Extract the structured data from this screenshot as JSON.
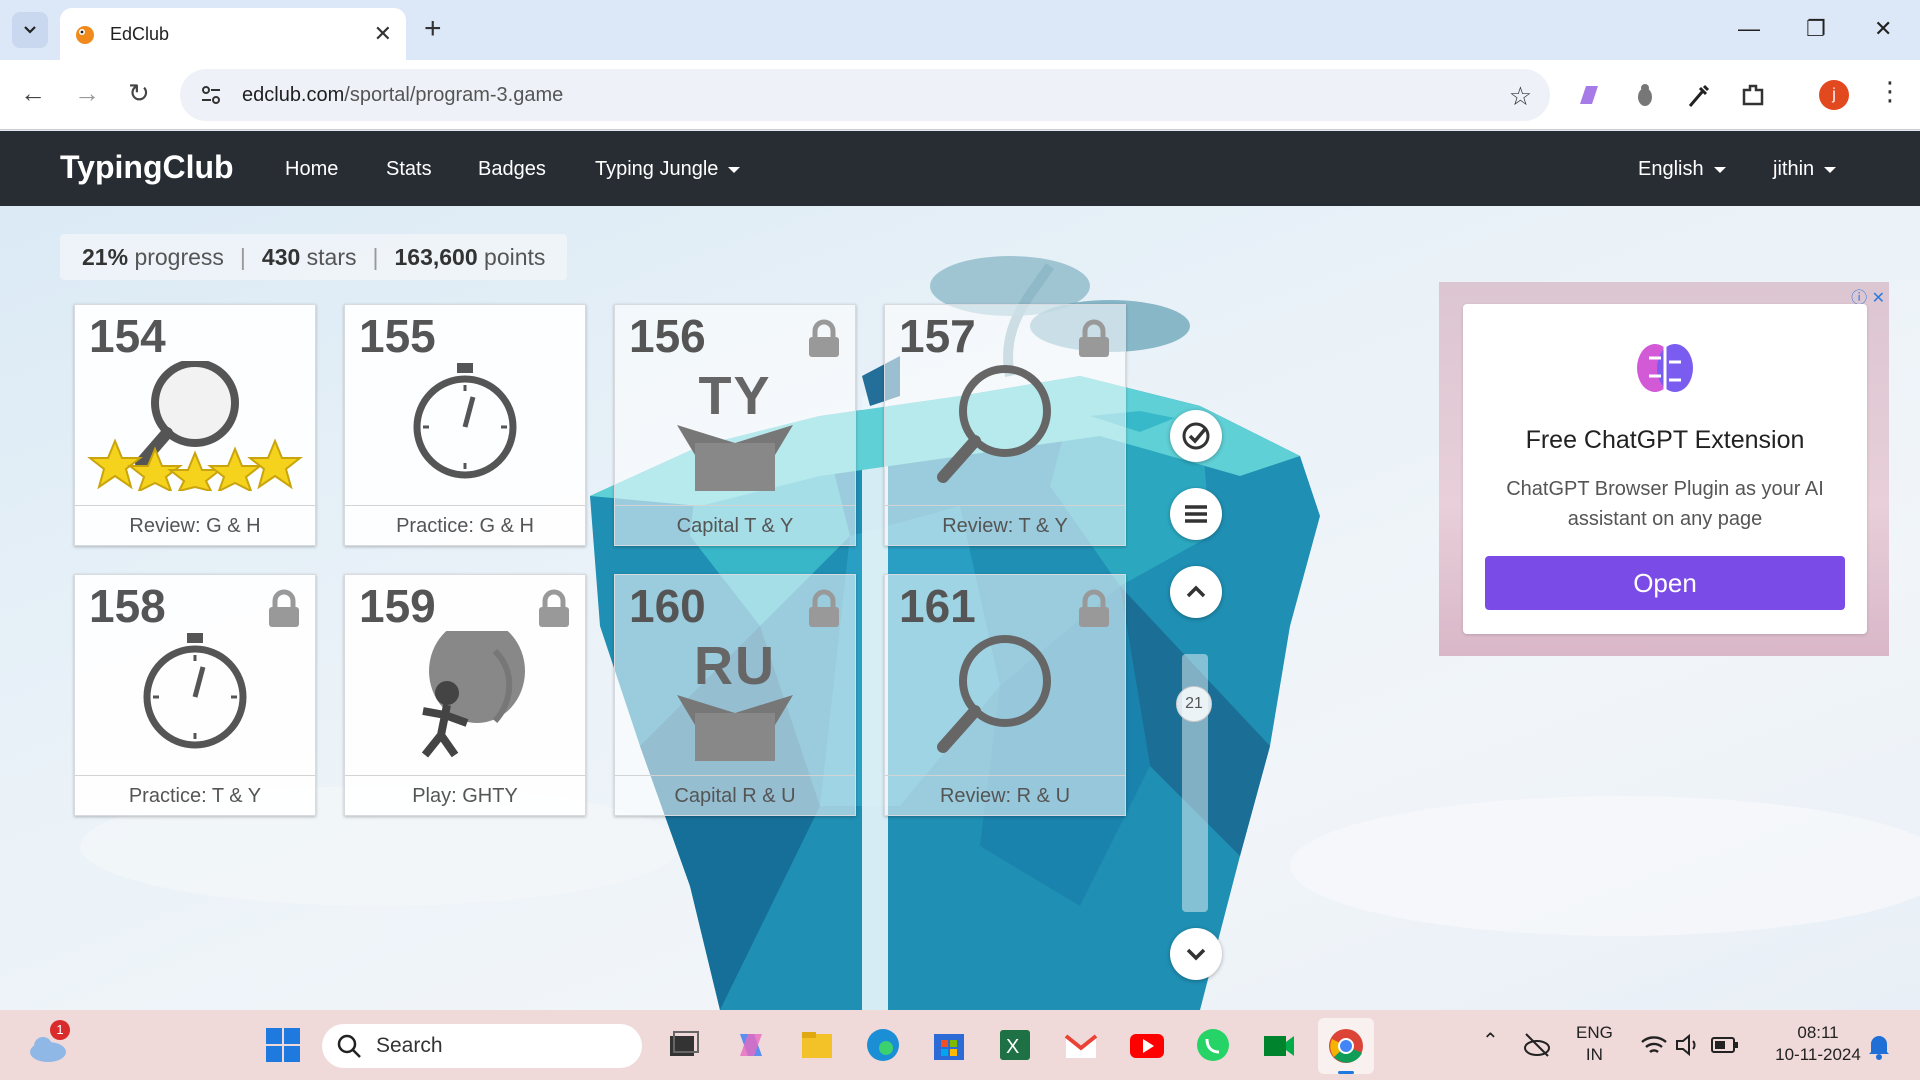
{
  "browser": {
    "tab_title": "EdClub",
    "url_host": "edclub.com",
    "url_path": "/sportal/program-3.game",
    "profile_initial": "j"
  },
  "site": {
    "brand": "TypingClub",
    "nav": [
      "Home",
      "Stats",
      "Badges",
      "Typing Jungle"
    ],
    "language": "English",
    "user": "jithin"
  },
  "stats": {
    "progress_value": "21%",
    "progress_label": "progress",
    "stars_value": "430",
    "stars_label": "stars",
    "points_value": "163,600",
    "points_label": "points"
  },
  "lessons": [
    {
      "number": "154",
      "label": "Review: G & H",
      "icon": "magnifier-stars-icon",
      "locked": false
    },
    {
      "number": "155",
      "label": "Practice: G & H",
      "icon": "stopwatch-icon",
      "locked": false
    },
    {
      "number": "156",
      "label": "Capital T & Y",
      "icon": "box-icon",
      "letters": "TY",
      "locked": true
    },
    {
      "number": "157",
      "label": "Review: T & Y",
      "icon": "magnifier-icon",
      "locked": true
    },
    {
      "number": "158",
      "label": "Practice: T & Y",
      "icon": "stopwatch-icon",
      "locked": true
    },
    {
      "number": "159",
      "label": "Play: GHTY",
      "icon": "balloon-game-icon",
      "locked": true
    },
    {
      "number": "160",
      "label": "Capital R & U",
      "icon": "box-icon",
      "letters": "RU",
      "locked": true
    },
    {
      "number": "161",
      "label": "Review: R & U",
      "icon": "magnifier-icon",
      "locked": true
    }
  ],
  "scroller": {
    "page": "21"
  },
  "ad": {
    "title": "Free ChatGPT Extension",
    "description": "ChatGPT Browser Plugin as your AI assistant on any page",
    "button": "Open"
  },
  "taskbar": {
    "search_placeholder": "Search",
    "weather_badge": "1",
    "lang_top": "ENG",
    "lang_bottom": "IN",
    "time": "08:11",
    "date": "10-11-2024"
  },
  "colors": {
    "nav_bg": "#282c33",
    "ad_button": "#7a4be6",
    "profile": "#e3491f",
    "island_teal": "#2aa7b8"
  }
}
